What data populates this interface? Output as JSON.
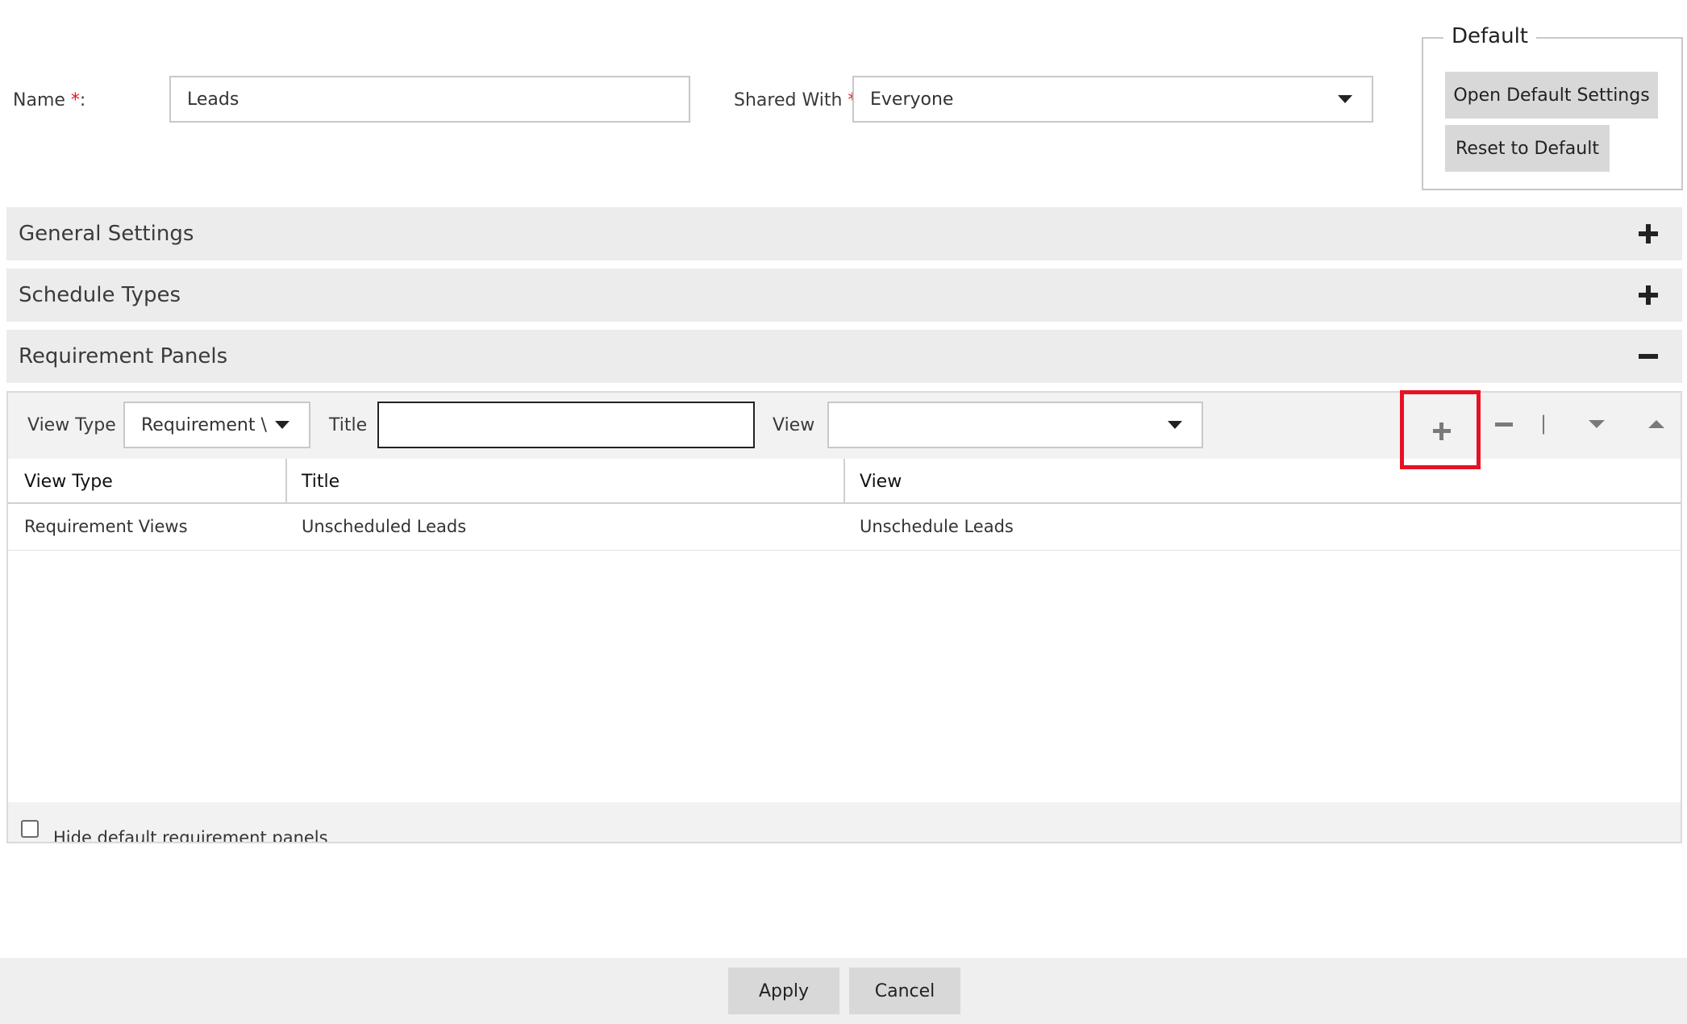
{
  "form": {
    "name_label": "Name",
    "name_value": "Leads",
    "shared_label": "Shared With",
    "shared_value": "Everyone",
    "required_mark": "*",
    "colon": ":"
  },
  "default_box": {
    "legend": "Default",
    "open_button": "Open Default Settings",
    "reset_button": "Reset to Default"
  },
  "sections": {
    "general": "General Settings",
    "schedule": "Schedule Types",
    "requirement": "Requirement Panels"
  },
  "panel_toolbar": {
    "view_type_label": "View Type",
    "view_type_value": "Requirement \\",
    "title_label": "Title",
    "title_value": "",
    "view_label": "View",
    "view_value": "",
    "separator": "|"
  },
  "grid": {
    "columns": [
      "View Type",
      "Title",
      "View"
    ],
    "rows": [
      [
        "Requirement Views",
        "Unscheduled Leads",
        "Unschedule Leads"
      ]
    ]
  },
  "hide_default_label": "Hide default requirement panels",
  "footer": {
    "apply": "Apply",
    "cancel": "Cancel"
  },
  "colors": {
    "highlight": "#e81123",
    "section_bg": "#ececec",
    "button_bg": "#d8d8d8"
  }
}
